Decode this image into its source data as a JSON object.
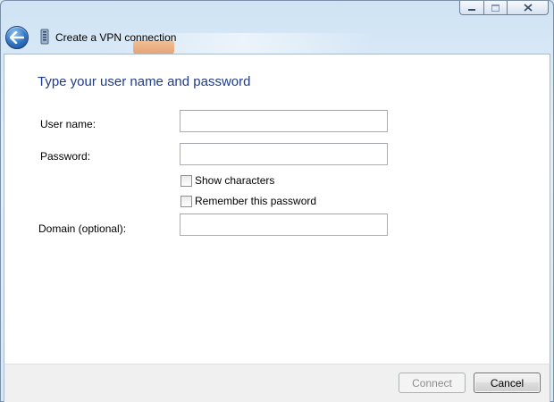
{
  "window": {
    "title": "Create a VPN connection"
  },
  "page": {
    "heading": "Type your user name and password"
  },
  "form": {
    "username": {
      "label": "User name:",
      "value": ""
    },
    "password": {
      "label": "Password:",
      "value": ""
    },
    "show_characters": {
      "label": "Show characters",
      "checked": false
    },
    "remember_password": {
      "label": "Remember this password",
      "checked": false
    },
    "domain": {
      "label": "Domain (optional):",
      "value": ""
    }
  },
  "footer": {
    "connect_label": "Connect",
    "connect_enabled": false,
    "cancel_label": "Cancel"
  },
  "icons": {
    "back": "back-arrow-icon",
    "vpn": "vpn-network-icon",
    "minimize": "minimize-icon",
    "maximize": "maximize-icon",
    "close": "close-icon"
  },
  "colors": {
    "heading": "#1e3b8a",
    "back_button": "#2e73c4",
    "footer": "#f0f0f0"
  }
}
